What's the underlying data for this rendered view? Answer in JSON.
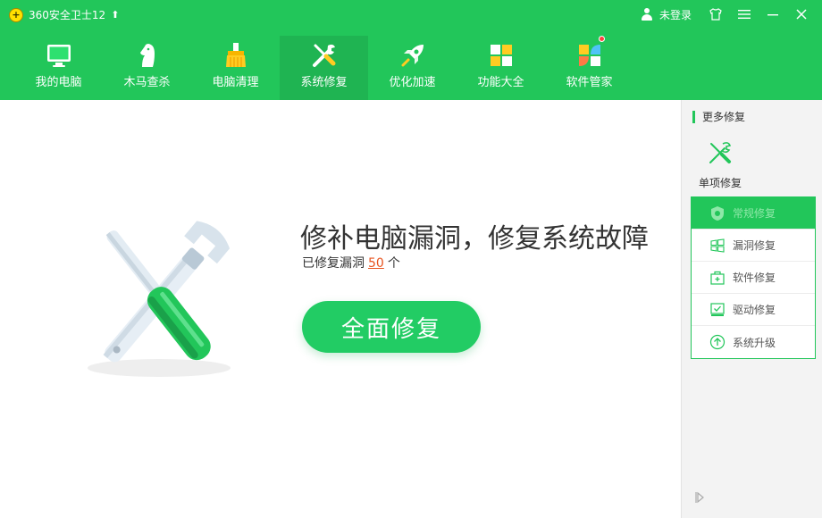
{
  "app": {
    "title": "360安全卫士12",
    "login_label": "未登录"
  },
  "nav": {
    "items": [
      {
        "label": "我的电脑",
        "icon": "monitor-icon"
      },
      {
        "label": "木马查杀",
        "icon": "horse-icon"
      },
      {
        "label": "电脑清理",
        "icon": "broom-icon"
      },
      {
        "label": "系统修复",
        "icon": "wrench-screwdriver-icon",
        "active": true
      },
      {
        "label": "优化加速",
        "icon": "rocket-icon"
      },
      {
        "label": "功能大全",
        "icon": "grid-icon"
      },
      {
        "label": "软件管家",
        "icon": "app-grid-icon",
        "badge": true
      }
    ]
  },
  "main": {
    "headline": "修补电脑漏洞，修复系统故障",
    "stat_prefix": "已修复漏洞",
    "stat_value": "50",
    "stat_suffix": "个",
    "repair_button": "全面修复"
  },
  "right_panel": {
    "title": "更多修复",
    "single_repair_label": "单项修复",
    "menu": [
      {
        "label": "常规修复",
        "icon": "shield-icon",
        "active": true
      },
      {
        "label": "漏洞修复",
        "icon": "windows-icon"
      },
      {
        "label": "软件修复",
        "icon": "toolbox-icon"
      },
      {
        "label": "驱动修复",
        "icon": "driver-icon"
      },
      {
        "label": "系统升级",
        "icon": "upgrade-icon"
      }
    ]
  },
  "colors": {
    "brand_green": "#22c65a",
    "button_green": "#22cc64",
    "accent_orange": "#e8531e"
  }
}
